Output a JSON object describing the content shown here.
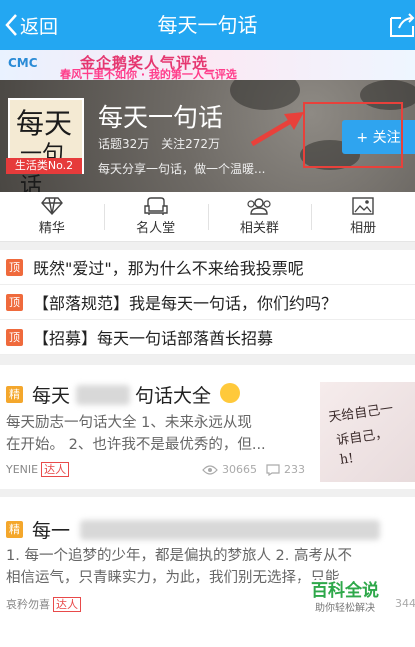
{
  "header": {
    "back_label": "返回",
    "title": "每天一句话"
  },
  "banner": {
    "logo": "CMC",
    "headline": "金企鹅奖人气评选",
    "sub": "春风十里不如你 · 我的第一人气评选"
  },
  "group": {
    "avatar_text_1": "每天",
    "avatar_text_2": "一句话",
    "rank_badge": "生活类No.2",
    "name": "每天一句话",
    "topics": "话题32万",
    "followers": "关注272万",
    "description": "每天分享一句话，做一个温暖...",
    "follow_label": "+ 关注"
  },
  "tabs": [
    {
      "label": "精华",
      "icon": "diamond-icon"
    },
    {
      "label": "名人堂",
      "icon": "sofa-icon"
    },
    {
      "label": "相关群",
      "icon": "group-icon"
    },
    {
      "label": "相册",
      "icon": "image-icon"
    }
  ],
  "pinned": [
    {
      "badge": "顶",
      "text": "既然\"爱过\"，那为什么不来给我投票呢"
    },
    {
      "badge": "顶",
      "text": "【部落规范】我是每天一句话，你们约吗？"
    },
    {
      "badge": "顶",
      "text": "【招募】每天一句话部落酋长招募"
    }
  ],
  "posts": [
    {
      "badge": "精",
      "title_start": "每天",
      "title_end": "句话大全",
      "excerpt_1": "每天励志一句话大全 1、未来永远从现",
      "excerpt_2": "在开始。 2、也许我不是最优秀的，但...",
      "author": "YENIE",
      "author_tag": "达人",
      "views": "30665",
      "comments": "233",
      "thumb_text_1": "天给自己一",
      "thumb_text_2": "诉自己，",
      "thumb_text_3": "h!"
    },
    {
      "badge": "精",
      "title_start": "每一",
      "excerpt_1": "1. 每一个追梦的少年，都是偏执的梦旅人 2. 高考从不",
      "excerpt_2": "相信运气，只青睐实力，为此，我们别无选择，只能",
      "author": "哀矜勿喜",
      "author_tag": "达人",
      "views_partial": "344"
    }
  ],
  "watermark": {
    "title": "百科全说",
    "sub": "助你轻松解决"
  }
}
